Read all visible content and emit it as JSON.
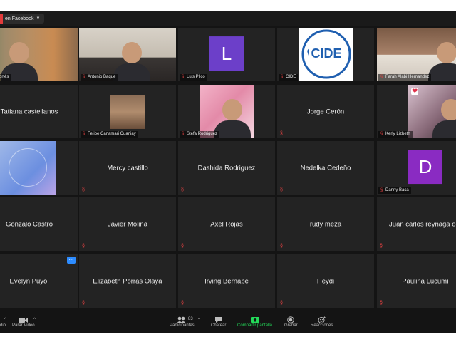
{
  "topbar": {
    "live_label": "en Facebook"
  },
  "tiles": [
    {
      "name": "Manuel Cortés",
      "label": "uel Cortés",
      "kind": "video",
      "active": true
    },
    {
      "name": "Antonio Baque",
      "label": "Antonio Baque",
      "kind": "video"
    },
    {
      "name": "Luis Pilco",
      "label": "Luis Pilco",
      "kind": "avatar",
      "letter": "L",
      "color": "#6c3fc9"
    },
    {
      "name": "CIDE",
      "label": "CIDE",
      "kind": "logo",
      "logo_text": "CIDE"
    },
    {
      "name": "Farah Alabi Hernández",
      "label": "Farah Alabi Hernandez",
      "kind": "video"
    },
    {
      "name": "Tatiana castellanos",
      "kind": "name"
    },
    {
      "name": "Felipe Canamari Cuaniay",
      "label": "Felipe Canamari Cuaniay",
      "kind": "video"
    },
    {
      "name": "Stefa Rodriguez",
      "label": "Stefa Rodriguez",
      "kind": "video"
    },
    {
      "name": "Jorge Cerón",
      "kind": "name"
    },
    {
      "name": "Kerly Lizbeth",
      "label": "Kerly Lizbeth",
      "kind": "video"
    },
    {
      "name": "screen-share",
      "kind": "share"
    },
    {
      "name": "Mercy castillo",
      "kind": "name"
    },
    {
      "name": "Dashida Rodriguez",
      "kind": "name"
    },
    {
      "name": "Nedelka Cedeño",
      "kind": "name"
    },
    {
      "name": "Danny Baca",
      "label": "Danny Baca",
      "kind": "avatar",
      "letter": "D",
      "color": "#8a2bc2"
    },
    {
      "name": "Gonzalo Castro",
      "kind": "name"
    },
    {
      "name": "Javier Molina",
      "kind": "name"
    },
    {
      "name": "Axel Rojas",
      "kind": "name"
    },
    {
      "name": "rudy meza",
      "kind": "name"
    },
    {
      "name": "Juan carlos reynaga ore",
      "kind": "name"
    },
    {
      "name": "Evelyn Puyol",
      "kind": "name",
      "more": true
    },
    {
      "name": "Elizabeth Porras Olaya",
      "kind": "name"
    },
    {
      "name": "Irving Bernabé",
      "kind": "name"
    },
    {
      "name": "Heydi",
      "kind": "name"
    },
    {
      "name": "Paulina Lucumí",
      "kind": "name"
    }
  ],
  "toolbar": {
    "audio": "dio",
    "video": "Parar Video",
    "participants": "Participantes",
    "participants_count": "83",
    "chat": "Chatear",
    "share": "Compartir pantalla",
    "record": "Grabar",
    "reactions": "Reacciones"
  },
  "colors": {
    "share_green": "#23d959",
    "active_border": "#c7d34a",
    "mic_red": "#e04040"
  }
}
